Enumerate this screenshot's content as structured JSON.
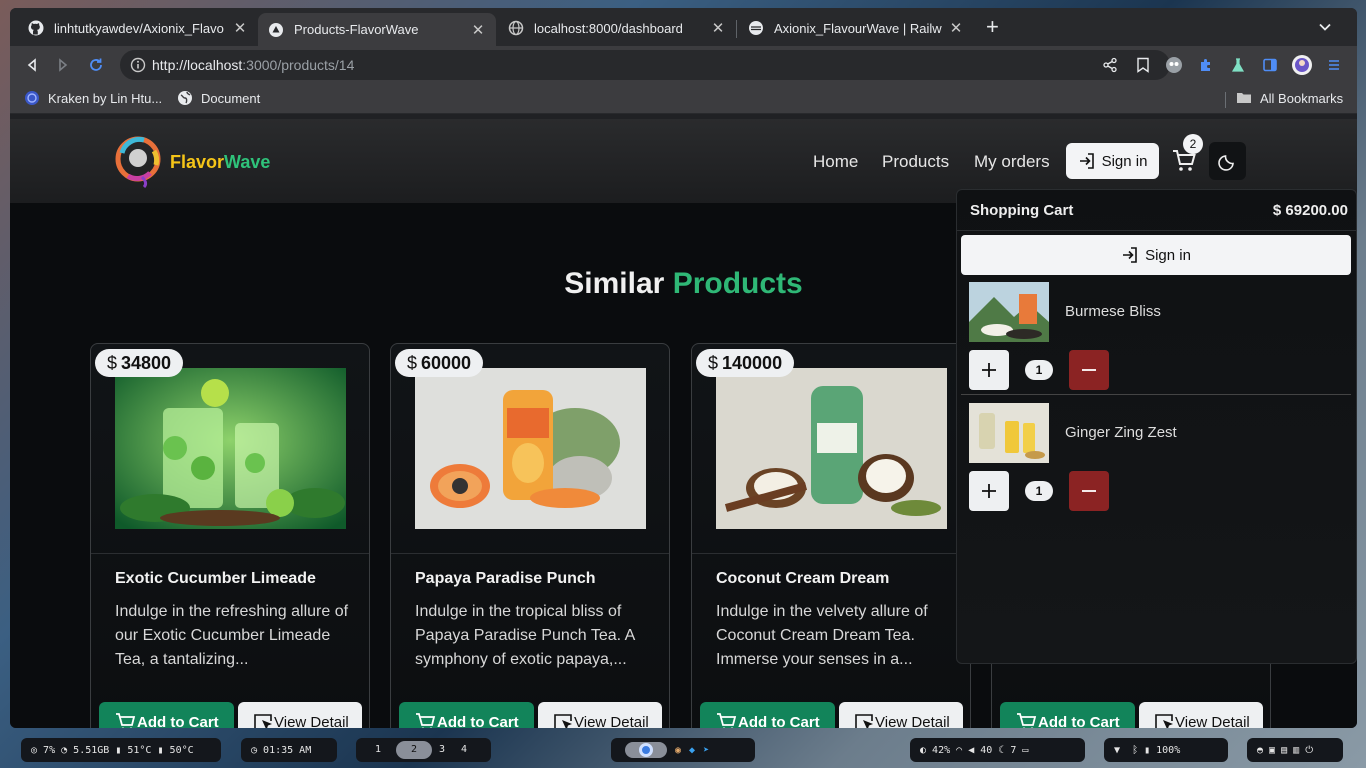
{
  "browser": {
    "tabs": [
      {
        "title": "linhtutkyawdev/Axionix_Flavo",
        "icon": "github-icon"
      },
      {
        "title": "Products-FlavorWave",
        "icon": "vercel-icon"
      },
      {
        "title": "localhost:8000/dashboard",
        "icon": "globe-icon"
      },
      {
        "title": "Axionix_FlavourWave | Railwa",
        "icon": "railway-icon"
      }
    ],
    "url_host": "http://localhost",
    "url_rest": ":3000/products/14",
    "bookmarks": [
      {
        "label": "Kraken by Lin Htu...",
        "icon": "kraken-icon"
      },
      {
        "label": "Document",
        "icon": "globe-icon"
      }
    ],
    "all_bookmarks": "All Bookmarks"
  },
  "site": {
    "brand_first": "Flavor",
    "brand_second": "Wave",
    "nav": [
      "Home",
      "Products",
      "My orders"
    ],
    "sign_in": "Sign in",
    "cart_count": "2",
    "accent": "#12845a"
  },
  "section": {
    "title_a": "Similar",
    "title_b": "Products"
  },
  "products": [
    {
      "price": "34800",
      "name": "Exotic Cucumber Limeade",
      "desc": "Indulge in the refreshing allure of our Exotic Cucumber Limeade Tea, a tantalizing...",
      "add": "Add to Cart",
      "view": "View Detail"
    },
    {
      "price": "60000",
      "name": "Papaya Paradise Punch",
      "desc": "Indulge in the tropical bliss of Papaya Paradise Punch Tea. A symphony of exotic papaya,...",
      "add": "Add to Cart",
      "view": "View Detail"
    },
    {
      "price": "140000",
      "name": "Coconut Cream Dream",
      "desc": "Indulge in the velvety allure of Coconut Cream Dream Tea. Immerse your senses in a...",
      "add": "Add to Cart",
      "view": "View Detail"
    },
    {
      "price": "",
      "name": "",
      "desc": "",
      "add": "Add to Cart",
      "view": "View Detail"
    }
  ],
  "cart": {
    "title": "Shopping Cart",
    "total": "69200.00",
    "sign_in": "Sign in",
    "items": [
      {
        "name": "Burmese Bliss",
        "qty": "1"
      },
      {
        "name": "Ginger Zing Zest",
        "qty": "1"
      }
    ]
  },
  "taskbar": {
    "cpu": "7%",
    "mem": "5.51GB",
    "temp1": "51°C",
    "temp2": "50°C",
    "time": "01:35 AM",
    "workspaces": [
      "1",
      "2",
      "3",
      "4"
    ],
    "brightness": "42%",
    "volume": "40",
    "moon": "7",
    "battery": "100%"
  }
}
